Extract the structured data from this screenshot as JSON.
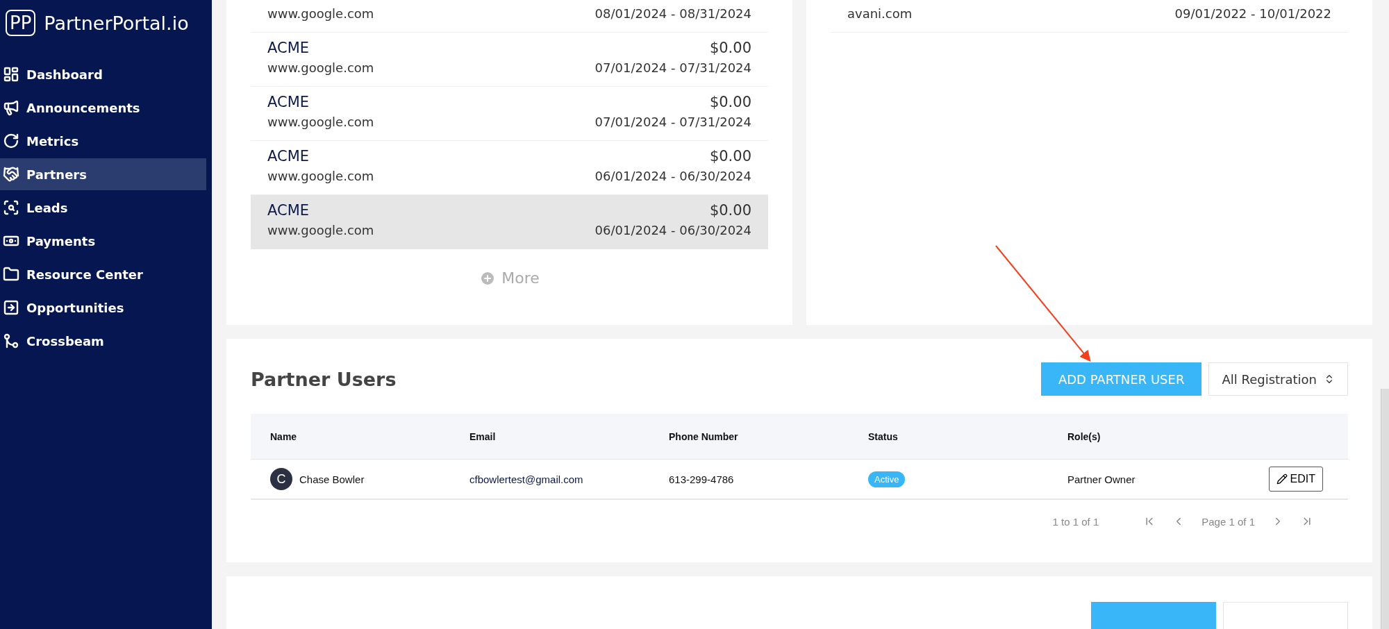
{
  "sidebar": {
    "logo": {
      "mark": "PP",
      "name": "PartnerPortal.io"
    },
    "items": [
      {
        "label": "Dashboard",
        "kind": "dashboard",
        "selected": false
      },
      {
        "label": "Announcements",
        "kind": "megaphone",
        "selected": false
      },
      {
        "label": "Metrics",
        "kind": "circle",
        "selected": false
      },
      {
        "label": "Partners",
        "kind": "handshake",
        "selected": true
      },
      {
        "label": "Leads",
        "kind": "search",
        "selected": false
      },
      {
        "label": "Payments",
        "kind": "money",
        "selected": false
      },
      {
        "label": "Resource Center",
        "kind": "folder",
        "selected": false
      },
      {
        "label": "Opportunities",
        "kind": "arrow",
        "selected": false
      },
      {
        "label": "Crossbeam",
        "kind": "beam",
        "selected": false
      }
    ]
  },
  "payouts": {
    "rows": [
      {
        "url": "www.google.com",
        "period": "08/01/2024 - 08/31/2024",
        "highlighted": false
      },
      {
        "name": "ACME",
        "url": "www.google.com",
        "amount": "$0.00",
        "period": "07/01/2024 - 07/31/2024",
        "highlighted": false
      },
      {
        "name": "ACME",
        "url": "www.google.com",
        "amount": "$0.00",
        "period": "07/01/2024 - 07/31/2024",
        "highlighted": false
      },
      {
        "name": "ACME",
        "url": "www.google.com",
        "amount": "$0.00",
        "period": "06/01/2024 - 06/30/2024",
        "highlighted": false
      },
      {
        "name": "ACME",
        "url": "www.google.com",
        "amount": "$0.00",
        "period": "06/01/2024 - 06/30/2024",
        "highlighted": true
      }
    ],
    "more_label": "More"
  },
  "other_payouts": {
    "rows": [
      {
        "url": "avani.com",
        "period": "09/01/2022 - 10/01/2022",
        "highlighted": false
      }
    ]
  },
  "partner_users": {
    "title": "Partner Users",
    "add_button": "ADD PARTNER USER",
    "filter": "All Registration",
    "columns": [
      "Name",
      "Email",
      "Phone Number",
      "Status",
      "Role(s)"
    ],
    "rows": [
      {
        "avatar": "C",
        "name": "Chase Bowler",
        "email": "cfbowlertest@gmail.com",
        "phone": "613-299-4786",
        "status": "Active",
        "role": "Partner Owner",
        "edit_label": "EDIT"
      }
    ],
    "pagination": {
      "range": "1 to 1 of 1",
      "page": "Page 1 of 1"
    }
  }
}
